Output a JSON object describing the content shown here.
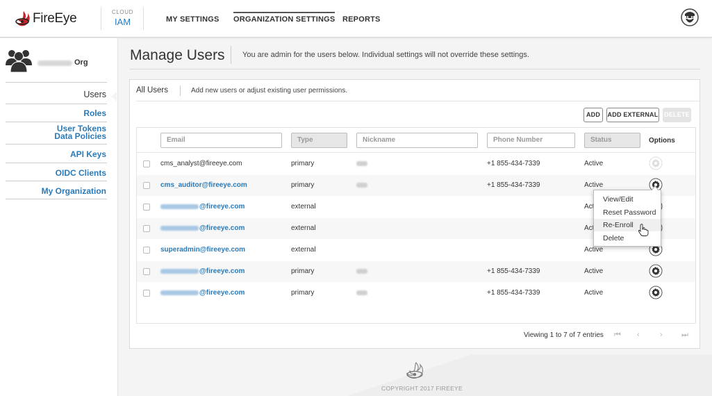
{
  "header": {
    "brand": "FireEye",
    "cloud_label": "CLOUD",
    "product": "IAM",
    "nav": [
      {
        "label": "MY SETTINGS",
        "active": false
      },
      {
        "label": "ORGANIZATION SETTINGS",
        "active": true
      },
      {
        "label": "REPORTS",
        "active": false
      }
    ],
    "avatar_icon": "bearded-user-icon"
  },
  "sidebar": {
    "org_icon": "users-group-icon",
    "org_suffix": "Org",
    "items": [
      {
        "label": "Users",
        "current": true
      },
      {
        "label": "Roles"
      },
      {
        "label": "User Tokens"
      },
      {
        "label": "Data Policies"
      },
      {
        "label": "API Keys"
      },
      {
        "label": "OIDC Clients"
      },
      {
        "label": "My Organization"
      }
    ]
  },
  "page": {
    "title": "Manage Users",
    "description": "You are admin for the users below. Individual settings will not override these settings."
  },
  "panel": {
    "title": "All Users",
    "subtitle": "Add new users or adjust existing user permissions.",
    "buttons": {
      "add": "ADD",
      "add_external": "ADD EXTERNAL",
      "delete": "DELETE"
    }
  },
  "table": {
    "filters": {
      "email": "Email",
      "type": "Type",
      "nickname": "Nickname",
      "phone": "Phone Number",
      "status": "Status"
    },
    "options_header": "Options",
    "rows": [
      {
        "email_prefix": "",
        "email": "cms_analyst@fireeye.com",
        "is_link": false,
        "type": "primary",
        "has_nick": true,
        "phone": "+1 855-434-7339",
        "status": "Active",
        "gear_disabled": true
      },
      {
        "email_prefix": "",
        "email": "cms_auditor@fireeye.com",
        "is_link": true,
        "type": "primary",
        "has_nick": true,
        "phone": "+1 855-434-7339",
        "status": "Active",
        "gear_disabled": false
      },
      {
        "email_prefix": "blurred",
        "email": "@fireeye.com",
        "is_link": true,
        "type": "external",
        "has_nick": false,
        "phone": "",
        "status": "Active",
        "gear_disabled": false
      },
      {
        "email_prefix": "blurred",
        "email": "@fireeye.com",
        "is_link": true,
        "type": "external",
        "has_nick": false,
        "phone": "",
        "status": "Active",
        "gear_disabled": false
      },
      {
        "email_prefix": "",
        "email": "superadmin@fireeye.com",
        "is_link": true,
        "type": "external",
        "has_nick": false,
        "phone": "",
        "status": "Active",
        "gear_disabled": false
      },
      {
        "email_prefix": "blurred",
        "email": "@fireeye.com",
        "is_link": true,
        "type": "primary",
        "has_nick": true,
        "phone": "+1 855-434-7339",
        "status": "Active",
        "gear_disabled": false
      },
      {
        "email_prefix": "blurred",
        "email": "@fireeye.com",
        "is_link": true,
        "type": "primary",
        "has_nick": true,
        "phone": "+1 855-434-7339",
        "status": "Active",
        "gear_disabled": false
      }
    ]
  },
  "pager": {
    "summary": "Viewing 1 to 7 of 7 entries",
    "first": "⏮",
    "prev": "‹",
    "next": "›",
    "last": "⏭"
  },
  "options_menu": {
    "items": [
      "View/Edit",
      "Reset Password",
      "Re-Enroll",
      "Delete"
    ],
    "hovered": "Re-Enroll"
  },
  "footer": {
    "copyright": "COPYRIGHT 2017 FIREEYE"
  },
  "colors": {
    "link": "#2a7ab8",
    "text": "#333333",
    "background": "#f4f4f4"
  }
}
